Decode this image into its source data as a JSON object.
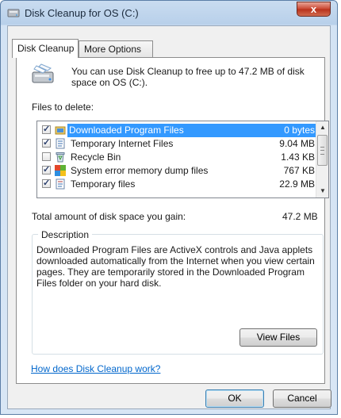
{
  "window": {
    "title": "Disk Cleanup for OS (C:)",
    "close_glyph": "x"
  },
  "tabs": [
    {
      "label": "Disk Cleanup"
    },
    {
      "label": "More Options"
    }
  ],
  "intro": {
    "line1": "You can use Disk Cleanup to free up to 47.2 MB of disk",
    "line2": "space on OS (C:)."
  },
  "files_label": "Files to delete:",
  "files": [
    {
      "name": "Downloaded Program Files",
      "size": "0 bytes",
      "checked": true,
      "selected": true,
      "icon": "folder-icon"
    },
    {
      "name": "Temporary Internet Files",
      "size": "9.04 MB",
      "checked": true,
      "selected": false,
      "icon": "document-icon"
    },
    {
      "name": "Recycle Bin",
      "size": "1.43 KB",
      "checked": false,
      "selected": false,
      "icon": "recycle-bin-icon"
    },
    {
      "name": "System error memory dump files",
      "size": "767 KB",
      "checked": true,
      "selected": false,
      "icon": "memory-dump-icon"
    },
    {
      "name": "Temporary files",
      "size": "22.9 MB",
      "checked": true,
      "selected": false,
      "icon": "document-icon"
    }
  ],
  "total": {
    "label": "Total amount of disk space you gain:",
    "value": "47.2 MB"
  },
  "description": {
    "title": "Description",
    "lines": [
      "Downloaded Program Files are ActiveX controls and Java applets",
      "downloaded automatically from the Internet when you view certain",
      "pages. They are temporarily stored in the Downloaded Program",
      "Files folder on your hard disk."
    ]
  },
  "buttons": {
    "view_files": "View Files",
    "ok": "OK",
    "cancel": "Cancel"
  },
  "help_link": "How does Disk Cleanup work?",
  "colors": {
    "selection": "#3399ff",
    "link": "#0066cc",
    "close": "#c9442f"
  }
}
